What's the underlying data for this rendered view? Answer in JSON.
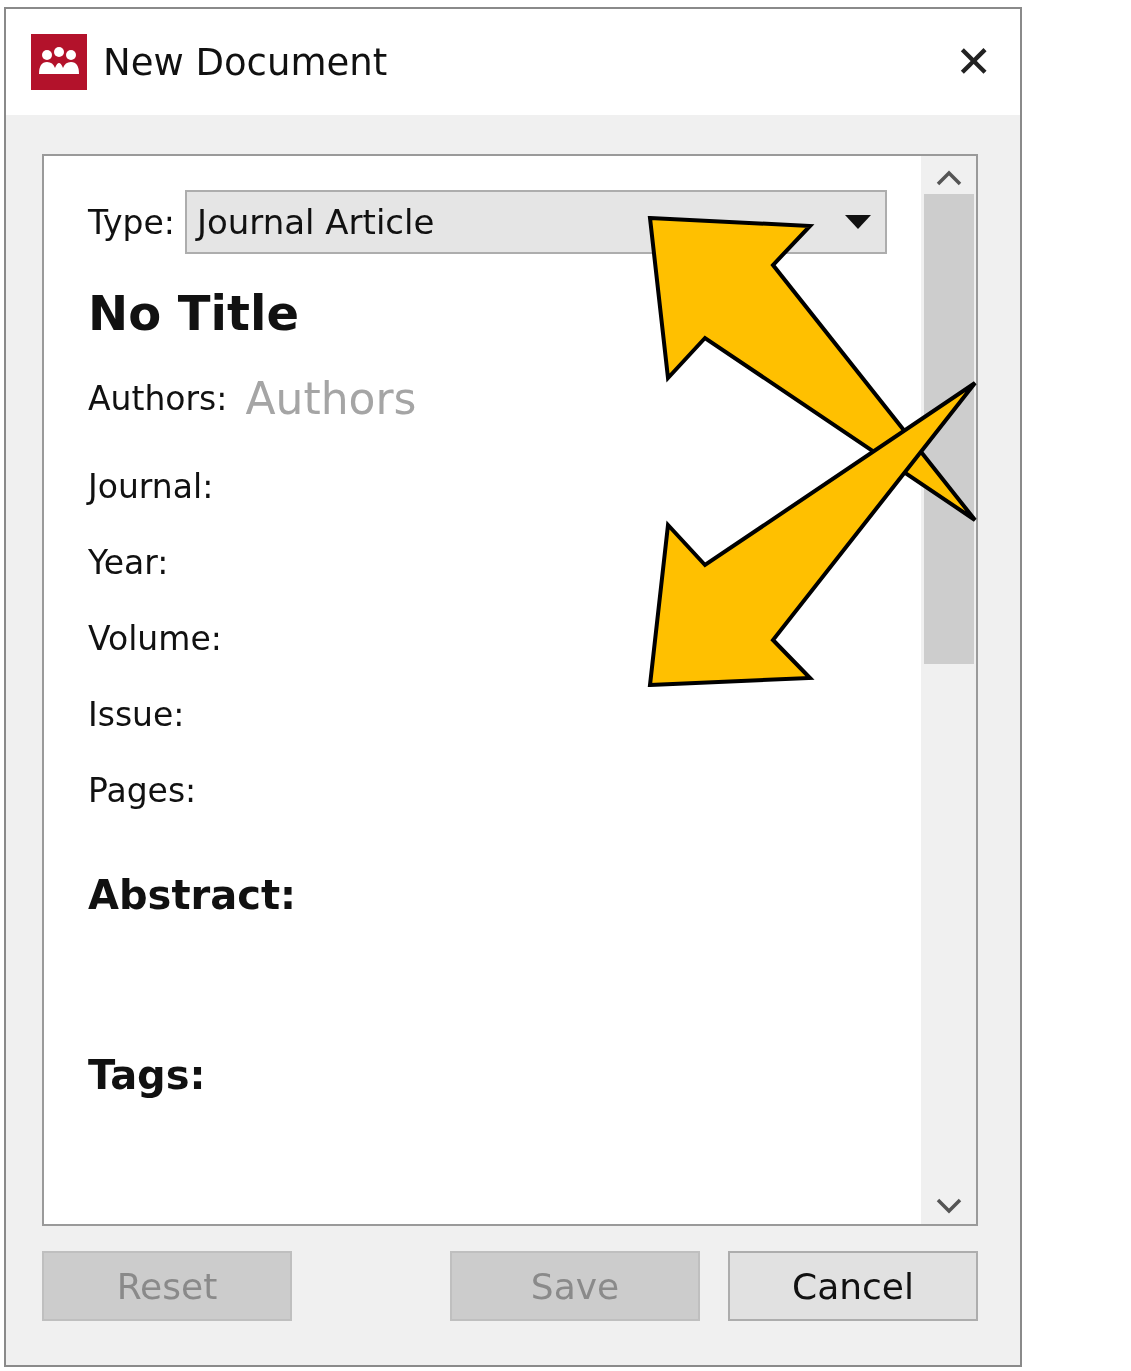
{
  "window": {
    "title": "New Document",
    "close_glyph": "✕"
  },
  "type_field": {
    "label": "Type:",
    "value": "Journal Article"
  },
  "document_title": "No Title",
  "fields": [
    {
      "kind": "authors",
      "label": "Authors:",
      "placeholder": "Authors"
    },
    {
      "kind": "field",
      "label": "Journal:"
    },
    {
      "kind": "field",
      "label": "Year:"
    },
    {
      "kind": "field",
      "label": "Volume:"
    },
    {
      "kind": "field",
      "label": "Issue:"
    },
    {
      "kind": "field",
      "label": "Pages:"
    },
    {
      "kind": "section",
      "label": "Abstract:"
    },
    {
      "kind": "section",
      "label": "Tags:"
    }
  ],
  "buttons": [
    {
      "label": "Reset",
      "disabled": true
    },
    {
      "label": "Save",
      "disabled": true
    },
    {
      "label": "Cancel",
      "disabled": false
    }
  ]
}
